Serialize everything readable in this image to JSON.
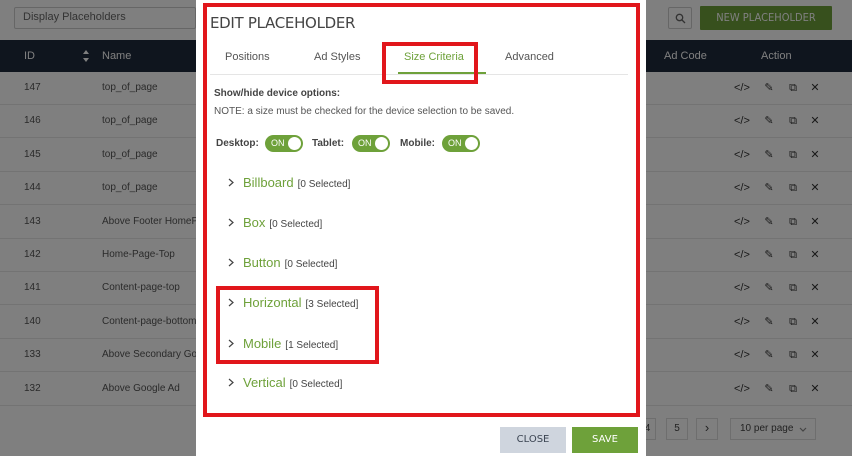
{
  "background": {
    "filter_select": "Display Placeholders",
    "new_button": "NEW PLACEHOLDER",
    "table_headers": {
      "id": "ID",
      "name": "Name",
      "ad_code": "Ad Code",
      "action": "Action"
    },
    "rows": [
      {
        "id": "147",
        "name": "top_of_page"
      },
      {
        "id": "146",
        "name": "top_of_page"
      },
      {
        "id": "145",
        "name": "top_of_page"
      },
      {
        "id": "144",
        "name": "top_of_page"
      },
      {
        "id": "143",
        "name": "Above Footer HomeP"
      },
      {
        "id": "142",
        "name": "Home-Page-Top"
      },
      {
        "id": "141",
        "name": "Content-page-top"
      },
      {
        "id": "140",
        "name": "Content-page-bottom"
      },
      {
        "id": "133",
        "name": "Above Secondary Go"
      },
      {
        "id": "132",
        "name": "Above Google Ad"
      }
    ],
    "pager": {
      "partial": "4",
      "page5": "5",
      "next": "›",
      "per_page": "10 per page"
    }
  },
  "modal": {
    "title": "EDIT PLACEHOLDER",
    "tabs": [
      "Positions",
      "Ad Styles",
      "Size Criteria",
      "Advanced"
    ],
    "active_tab": "Size Criteria",
    "section_title": "Show/hide device options:",
    "note": "NOTE: a size must be checked for the device selection to be saved.",
    "devices": [
      {
        "label": "Desktop:",
        "state": "ON"
      },
      {
        "label": "Tablet:",
        "state": "ON"
      },
      {
        "label": "Mobile:",
        "state": "ON"
      }
    ],
    "sizes": [
      {
        "name": "Billboard",
        "count": "[0 Selected]"
      },
      {
        "name": "Box",
        "count": "[0 Selected]"
      },
      {
        "name": "Button",
        "count": "[0 Selected]"
      },
      {
        "name": "Horizontal",
        "count": "[3 Selected]"
      },
      {
        "name": "Mobile",
        "count": "[1 Selected]"
      },
      {
        "name": "Vertical",
        "count": "[0 Selected]"
      }
    ],
    "close_label": "CLOSE",
    "save_label": "SAVE"
  },
  "colors": {
    "accent": "#6ea13a",
    "header_dark": "#1f2a3d",
    "highlight": "#e1161b",
    "close_button": "#cfd5de"
  }
}
